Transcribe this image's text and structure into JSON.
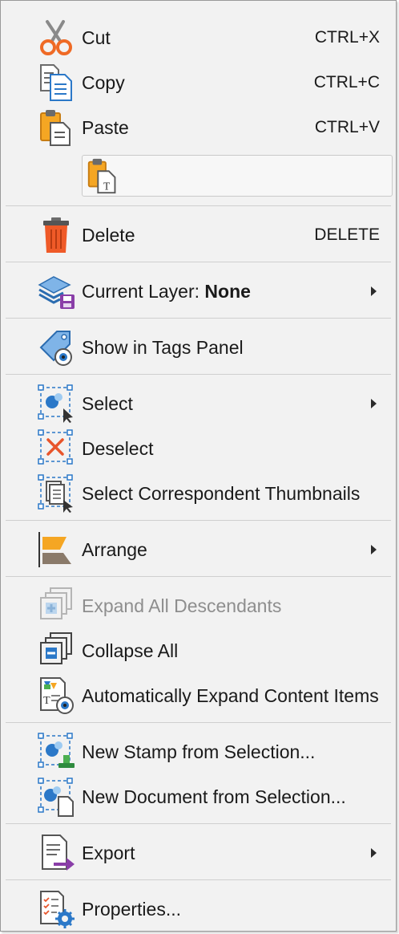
{
  "menu": {
    "cut": {
      "label": "Cut",
      "shortcut": "CTRL+X",
      "icon": "scissors-icon"
    },
    "copy": {
      "label": "Copy",
      "shortcut": "CTRL+C",
      "icon": "copy-icon"
    },
    "paste": {
      "label": "Paste",
      "shortcut": "CTRL+V",
      "icon": "paste-icon"
    },
    "paste_special": {
      "icon": "paste-text-icon"
    },
    "delete": {
      "label": "Delete",
      "shortcut": "DELETE",
      "icon": "trash-icon"
    },
    "current_layer": {
      "label": "Current Layer: ",
      "value": "None",
      "icon": "layers-icon"
    },
    "show_in_tags": {
      "label": "Show in Tags Panel",
      "icon": "tag-view-icon"
    },
    "select": {
      "label": "Select",
      "icon": "select-icon"
    },
    "deselect": {
      "label": "Deselect",
      "icon": "deselect-icon"
    },
    "select_thumbnails": {
      "label": "Select Correspondent Thumbnails",
      "icon": "thumbnails-select-icon"
    },
    "arrange": {
      "label": "Arrange",
      "icon": "arrange-icon"
    },
    "expand_all": {
      "label": "Expand All Descendants",
      "icon": "expand-icon",
      "enabled": false
    },
    "collapse_all": {
      "label": "Collapse All",
      "icon": "collapse-icon"
    },
    "auto_expand": {
      "label": "Automatically Expand Content Items",
      "icon": "auto-expand-icon"
    },
    "new_stamp": {
      "label": "New Stamp from Selection...",
      "icon": "stamp-icon"
    },
    "new_document": {
      "label": "New Document from Selection...",
      "icon": "new-document-icon"
    },
    "export": {
      "label": "Export",
      "icon": "export-icon"
    },
    "properties": {
      "label": "Properties...",
      "icon": "properties-icon"
    }
  },
  "colors": {
    "menu_bg": "#f2f2f2",
    "separator": "#cfcfcf",
    "text": "#1a1a1a",
    "disabled_text": "#8e8e8e",
    "accent_blue": "#2b78c8",
    "accent_orange": "#ef6a25"
  }
}
